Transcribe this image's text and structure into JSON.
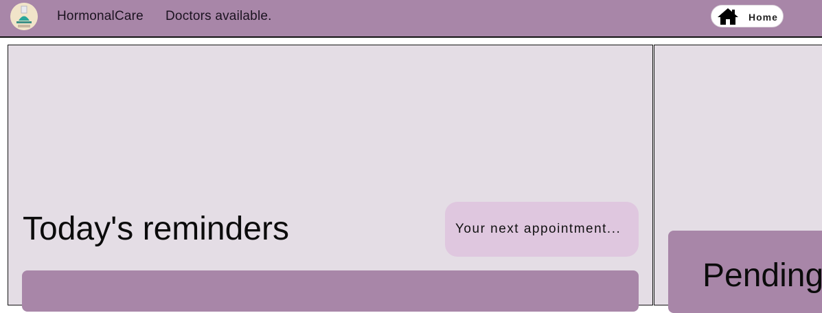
{
  "header": {
    "app_name": "HormonalCare",
    "doctors_link": "Doctors available.",
    "home_button_label": "Home",
    "logo_icon": "hormonal-care-logo-icon",
    "home_icon": "house-icon",
    "accent_color": "#a886a8"
  },
  "main": {
    "reminders_title": "Today's reminders",
    "next_appointment_label": "Your next appointment...",
    "pending_title": "Pending"
  },
  "colors": {
    "panel_background": "#e4dde5",
    "appointment_badge": "#dfc7df",
    "card": "#a886a8"
  }
}
